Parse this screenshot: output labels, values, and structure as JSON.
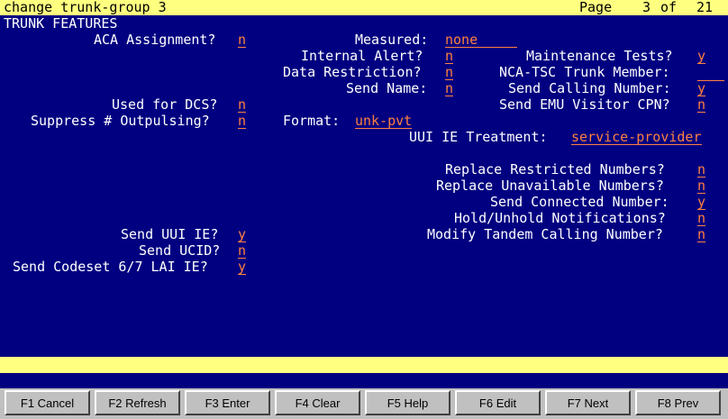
{
  "titlebar": {
    "command": "change trunk-group 3",
    "page_label": "Page",
    "page_current": "3",
    "page_of": "of",
    "page_total": "21"
  },
  "section_title": "TRUNK FEATURES",
  "fields": {
    "aca_assignment": {
      "label": "ACA Assignment?",
      "value": "n"
    },
    "measured": {
      "label": "Measured:",
      "value": "none"
    },
    "internal_alert": {
      "label": "Internal Alert?",
      "value": "n"
    },
    "maintenance_tests": {
      "label": "Maintenance Tests?",
      "value": "y"
    },
    "data_restriction": {
      "label": "Data Restriction?",
      "value": "n"
    },
    "nca_tsc_trunk_member": {
      "label": "NCA-TSC Trunk Member:",
      "value": ""
    },
    "send_name": {
      "label": "Send Name:",
      "value": "n"
    },
    "send_calling_number": {
      "label": "Send Calling Number:",
      "value": "y"
    },
    "used_for_dcs": {
      "label": "Used for DCS?",
      "value": "n"
    },
    "send_emu_visitor_cpn": {
      "label": "Send EMU Visitor CPN?",
      "value": "n"
    },
    "suppress_outpulsing": {
      "label": "Suppress # Outpulsing?",
      "value": "n"
    },
    "format": {
      "label": "Format:",
      "value": "unk-pvt"
    },
    "uui_ie_treatment": {
      "label": "UUI IE Treatment:",
      "value": "service-provider"
    },
    "replace_restricted_numbers": {
      "label": "Replace Restricted Numbers?",
      "value": "n"
    },
    "replace_unavailable_numbers": {
      "label": "Replace Unavailable Numbers?",
      "value": "n"
    },
    "send_connected_number": {
      "label": "Send Connected Number:",
      "value": "y"
    },
    "hold_unhold_notifications": {
      "label": "Hold/Unhold Notifications?",
      "value": "n"
    },
    "send_uui_ie": {
      "label": "Send UUI IE?",
      "value": "y"
    },
    "modify_tandem_calling_number": {
      "label": "Modify Tandem Calling Number?",
      "value": "n"
    },
    "send_ucid": {
      "label": "Send UCID?",
      "value": "n"
    },
    "send_codeset_lai_ie": {
      "label": "Send Codeset 6/7 LAI IE?",
      "value": "y"
    }
  },
  "function_keys": [
    {
      "label": "F1 Cancel"
    },
    {
      "label": "F2 Refresh"
    },
    {
      "label": "F3 Enter"
    },
    {
      "label": "F4 Clear"
    },
    {
      "label": "F5 Help"
    },
    {
      "label": "F6 Edit"
    },
    {
      "label": "F7 Next"
    },
    {
      "label": "F8 Prev"
    }
  ],
  "colors": {
    "background": "#000080",
    "bar": "#ffff80",
    "value": "#ff8040",
    "text": "#ffffff"
  }
}
